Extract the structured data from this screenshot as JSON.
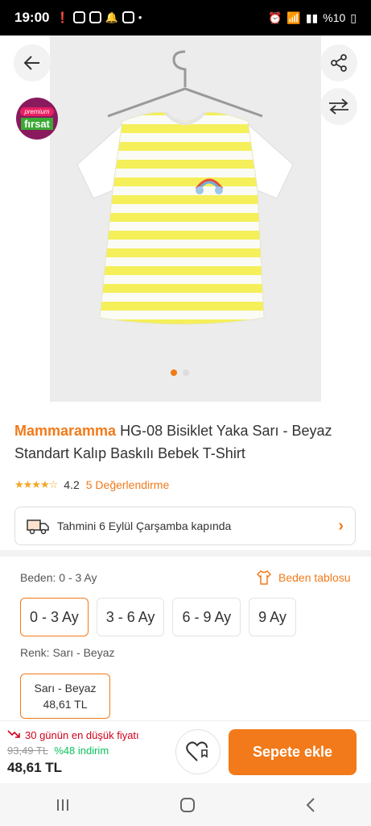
{
  "status_bar": {
    "time": "19:00",
    "battery": "%10"
  },
  "product": {
    "brand": "Mammaramma",
    "title": "HG-08 Bisiklet Yaka Sarı - Beyaz Standart Kalıp Baskılı Bebek T-Shirt",
    "rating": "4.2",
    "reviews_label": "5 Değerlendirme",
    "badge_top": "premium",
    "badge_bottom": "fırsat"
  },
  "delivery": {
    "text": "Tahmini 6 Eylül Çarşamba kapında"
  },
  "size": {
    "label": "Beden: 0 - 3 Ay",
    "table_link": "Beden tablosu",
    "options": [
      "0 - 3 Ay",
      "3 - 6 Ay",
      "6 - 9 Ay",
      "9 Ay"
    ],
    "selected": "0 - 3 Ay"
  },
  "color": {
    "label": "Renk: Sarı - Beyaz",
    "option_name": "Sarı - Beyaz",
    "option_price": "48,61 TL"
  },
  "pricing": {
    "lowest_note": "30 günün en düşük fiyatı",
    "old_price": "93,49 TL",
    "discount": "%48 indirim",
    "price": "48,61 TL"
  },
  "actions": {
    "add_to_cart": "Sepete ekle"
  },
  "colors": {
    "accent": "#f27a1a",
    "sale_red": "#d0021b",
    "discount_green": "#0bc15c"
  }
}
